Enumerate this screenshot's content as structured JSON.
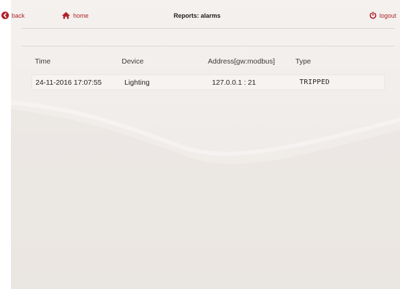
{
  "header": {
    "back_label": "back",
    "home_label": "home",
    "title": "Reports: alarms",
    "logout_label": "logout"
  },
  "table": {
    "columns": [
      "Time",
      "Device",
      "Address[gw:modbus]",
      "Type"
    ],
    "rows": [
      [
        "24-11-2016 17:07:55",
        "Lighting",
        "127.0.0.1 : 21",
        "TRIPPED"
      ]
    ]
  },
  "colors": {
    "accent": "#b0232a",
    "panel_bg": "#efebe8"
  },
  "icons": {
    "back": "back-arrow-circle-icon",
    "home": "home-icon",
    "logout": "power-icon"
  }
}
